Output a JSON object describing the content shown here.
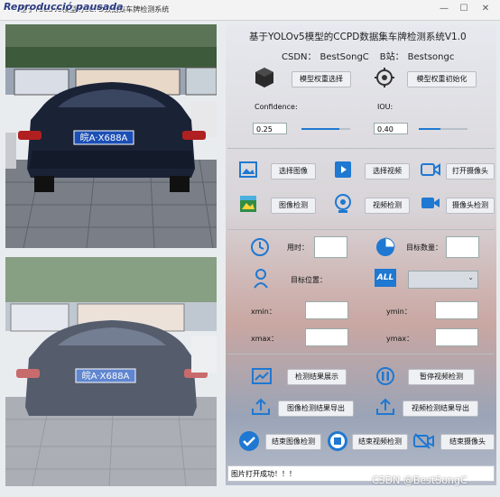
{
  "window": {
    "title": "基于YOLOv5模型的CCPD数据集车牌检测系统",
    "overlay_text": "Reproducció pausada",
    "minimize": "—",
    "maximize": "☐",
    "close": "✕"
  },
  "header": {
    "title": "基于YOLOv5模型的CCPD数据集车牌检测系统V1.0",
    "csdn_label": "CSDN：",
    "csdn_value": "BestSongC",
    "bilibili_label": "B站：",
    "bilibili_value": "Bestsongc"
  },
  "model": {
    "select_weights": "模型权重选择",
    "init_weights": "模型权重初始化"
  },
  "params": {
    "confidence_label": "Confidence:",
    "confidence_value": "0.25",
    "confidence_fraction": 0.25,
    "iou_label": "IOU:",
    "iou_value": "0.40",
    "iou_fraction": 0.4
  },
  "actions": {
    "select_image": "选择图像",
    "select_video": "选择视频",
    "open_camera": "打开摄像头",
    "image_detect": "图像检测",
    "video_detect": "视频检测",
    "camera_detect": "摄像头检测"
  },
  "results": {
    "time_label": "用时：",
    "count_label": "目标数量：",
    "position_label": "目标位置：",
    "all_icon_text": "ALL",
    "xmin_label": "xmin：",
    "ymin_label": "ymin：",
    "xmax_label": "xmax：",
    "ymax_label": "ymax："
  },
  "bottom": {
    "show_results": "检测结果展示",
    "pause_video": "暂停视频检测",
    "export_image": "图像检测结果导出",
    "export_video": "视频检测结果导出",
    "end_image": "结束图像检测",
    "end_video": "结束视频检测",
    "end_camera": "结束摄像头"
  },
  "status": {
    "message": "图片打开成功！！！"
  },
  "plate": {
    "text": "皖A·X688A"
  },
  "watermark": "CSDN @BestSongC",
  "colors": {
    "accent": "#1f78d1",
    "plate_blue": "#1c4fb5",
    "title_overlay": "#2a3b80"
  }
}
